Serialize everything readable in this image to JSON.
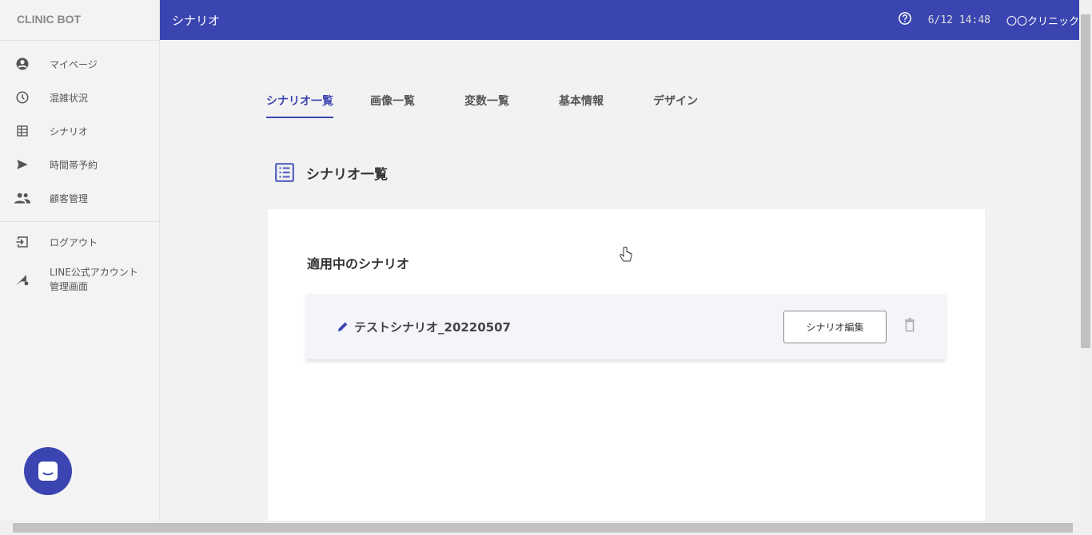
{
  "sidebar": {
    "brand": "CLINIC BOT",
    "items": [
      {
        "label": "マイページ",
        "icon": "account-circle-icon"
      },
      {
        "label": "混雑状況",
        "icon": "clock-icon"
      },
      {
        "label": "シナリオ",
        "icon": "table-icon"
      },
      {
        "label": "時間帯予約",
        "icon": "send-icon"
      },
      {
        "label": "顧客管理",
        "icon": "people-icon"
      }
    ],
    "logout": "ログアウト",
    "line_line1": "LINE公式アカウント",
    "line_line2": "管理画面"
  },
  "header": {
    "title": "シナリオ",
    "datetime": "6/12 14:48",
    "clinic": "〇〇クリニック"
  },
  "tabs": [
    "シナリオ一覧",
    "画像一覧",
    "変数一覧",
    "基本情報",
    "デザイン"
  ],
  "section_title": "シナリオ一覧",
  "card": {
    "heading": "適用中のシナリオ",
    "scenario_name": "テストシナリオ_20220507",
    "edit_button": "シナリオ編集"
  },
  "colors": {
    "primary": "#3b45b1"
  }
}
